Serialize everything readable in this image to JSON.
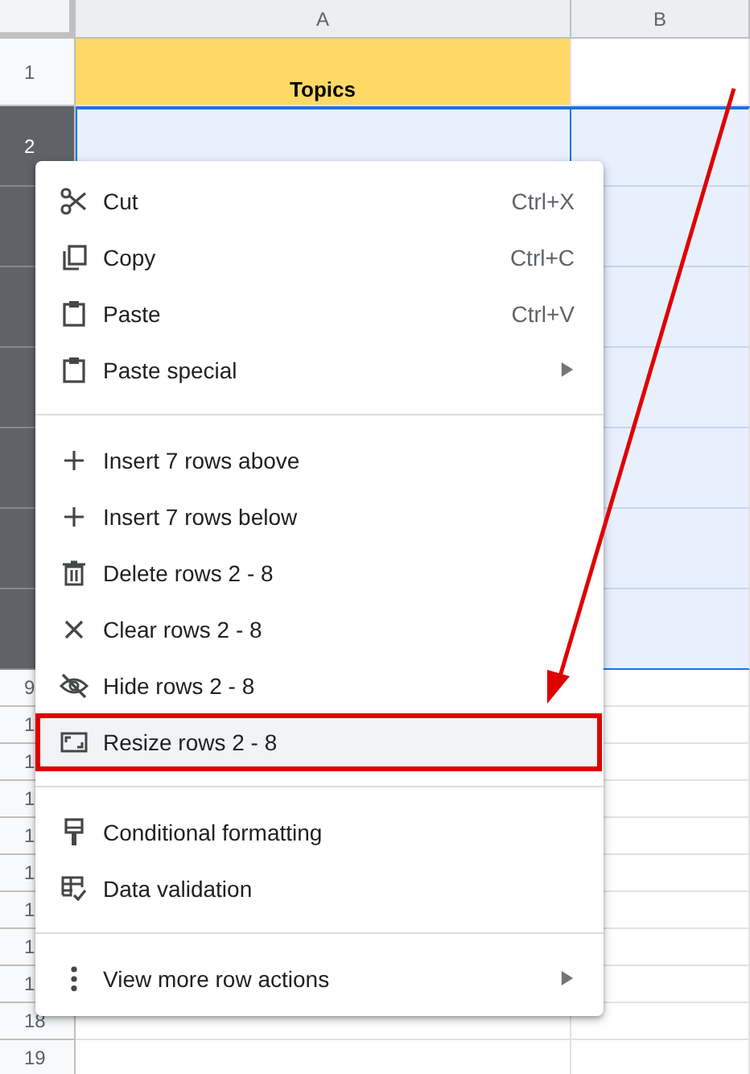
{
  "columns": [
    {
      "label": "A"
    },
    {
      "label": "B"
    }
  ],
  "rows": [
    {
      "label": "1",
      "selected": false,
      "cells": [
        {
          "text": "Topics",
          "color": "#ffd966"
        }
      ]
    },
    {
      "label": "2",
      "selected": true
    },
    {
      "selected": true
    },
    {
      "selected": true
    },
    {
      "selected": true
    },
    {
      "selected": true
    },
    {
      "selected": true
    },
    {
      "selected": true
    },
    {
      "label": "9",
      "selected": false
    },
    {
      "label": "1",
      "selected": false
    },
    {
      "label": "1",
      "selected": false
    },
    {
      "label": "1",
      "selected": false
    },
    {
      "label": "1",
      "selected": false
    },
    {
      "label": "1",
      "selected": false
    },
    {
      "label": "1",
      "selected": false
    },
    {
      "label": "1",
      "selected": false
    },
    {
      "label": "1",
      "selected": false
    },
    {
      "label": "18",
      "selected": false
    },
    {
      "label": "19",
      "selected": false
    }
  ],
  "context_menu": {
    "items": [
      {
        "kind": "item",
        "label": "Cut",
        "shortcut": "Ctrl+X",
        "selected": false
      },
      {
        "kind": "item",
        "label": "Copy",
        "shortcut": "Ctrl+C",
        "selected": false
      },
      {
        "kind": "item",
        "label": "Paste",
        "shortcut": "Ctrl+V",
        "selected": false
      },
      {
        "kind": "item",
        "label": "Paste special",
        "submenu": true,
        "selected": false
      },
      {
        "kind": "separator"
      },
      {
        "kind": "item",
        "label": "Insert 7 rows above",
        "selected": false
      },
      {
        "kind": "item",
        "label": "Insert 7 rows below",
        "selected": false
      },
      {
        "kind": "item",
        "label": "Delete rows 2 - 8",
        "selected": false
      },
      {
        "kind": "item",
        "label": "Clear rows 2 - 8",
        "selected": false
      },
      {
        "kind": "item",
        "label": "Hide rows 2 - 8",
        "selected": false
      },
      {
        "kind": "item",
        "label": "Resize rows 2 - 8",
        "selected": true
      },
      {
        "kind": "separator"
      },
      {
        "kind": "item",
        "label": "Conditional formatting",
        "selected": false
      },
      {
        "kind": "item",
        "label": "Data validation",
        "selected": false
      },
      {
        "kind": "separator"
      },
      {
        "kind": "item",
        "label": "View more row actions",
        "submenu": true,
        "selected": false
      }
    ]
  }
}
